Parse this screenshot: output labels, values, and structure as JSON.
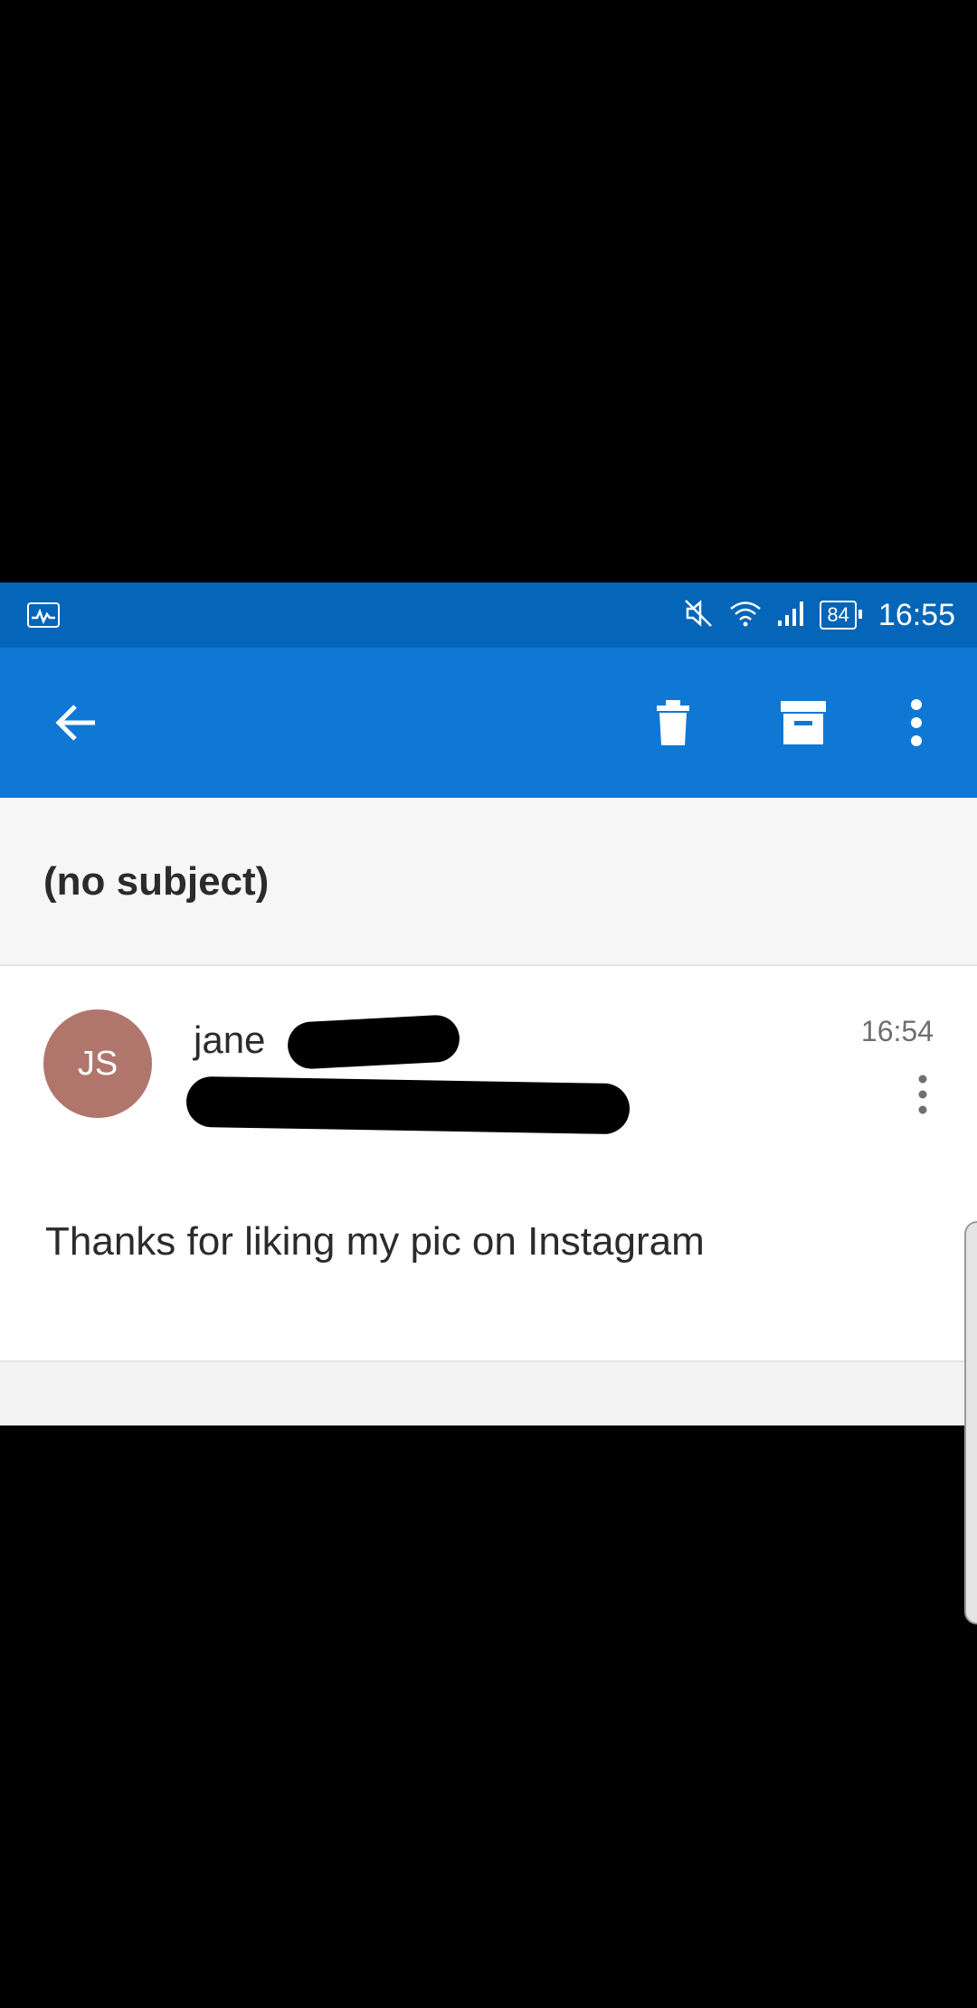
{
  "status_bar": {
    "battery": "84",
    "time": "16:55",
    "icons": [
      "activity-icon",
      "mute-icon",
      "wifi-icon",
      "signal-icon",
      "battery-icon"
    ]
  },
  "toolbar": {
    "icons": [
      "back-arrow-icon",
      "trash-icon",
      "archive-icon",
      "more-vert-icon"
    ]
  },
  "email": {
    "subject": "(no subject)",
    "avatar_initials": "JS",
    "sender_name": "jane",
    "time": "16:54",
    "body": "Thanks for liking my pic on Instagram"
  },
  "colors": {
    "status_bar": "#0565b8",
    "toolbar": "#0f78d4",
    "avatar": "#b0766c",
    "subject_bg": "#f6f6f6"
  }
}
